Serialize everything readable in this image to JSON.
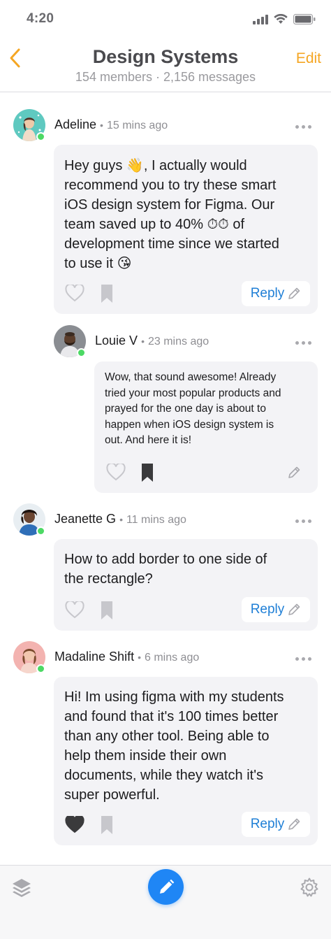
{
  "status_bar": {
    "time": "4:20",
    "icons": [
      "signal-icon",
      "wifi-icon",
      "battery-icon"
    ]
  },
  "header": {
    "back_icon": "chevron-left-icon",
    "title": "Design Systems",
    "subtitle": "154 members · 2,156 messages",
    "edit_label": "Edit"
  },
  "messages": [
    {
      "author": "Adeline",
      "time": "15 mins ago",
      "online": true,
      "text_lines": [
        "Hey guys 👋, I actually would",
        "recommend you to try these smart",
        "iOS design system for Figma. Our",
        "team saved up to 40% ⏱⏱ of",
        "development time since we started",
        "to use it 😘"
      ],
      "liked": false,
      "bookmarked": false,
      "reply_label": "Reply"
    },
    {
      "author": "Louie V",
      "time": "23 mins ago",
      "online": true,
      "text_lines": [
        "Wow, that sound awesome! Already",
        "tried your most popular products and",
        "prayed for the one day is about to",
        "happen when iOS design system is",
        "out. And here it is!"
      ],
      "liked": false,
      "bookmarked": true
    },
    {
      "author": "Jeanette G",
      "time": "11 mins ago",
      "online": true,
      "text_lines": [
        "How to add border to one side of",
        "the rectangle?"
      ],
      "liked": false,
      "bookmarked": false,
      "reply_label": "Reply"
    },
    {
      "author": "Madaline Shift",
      "time": "6 mins ago",
      "online": true,
      "text_lines": [
        "Hi! Im using figma with my students",
        "and found that it's 100 times better",
        "than any other tool. Being able to",
        "help them inside their own",
        "documents, while they watch it's",
        "super powerful."
      ],
      "liked": true,
      "bookmarked": false,
      "reply_label": "Reply"
    }
  ],
  "tab_bar": {
    "left_icon": "layers-icon",
    "center_icon": "pencil-icon",
    "right_icon": "gear-icon"
  },
  "colors": {
    "accent": "#f5a623",
    "link": "#1f7fd6",
    "compose": "#1f86f5",
    "online": "#4cd964",
    "bubble": "#f3f3f6"
  }
}
